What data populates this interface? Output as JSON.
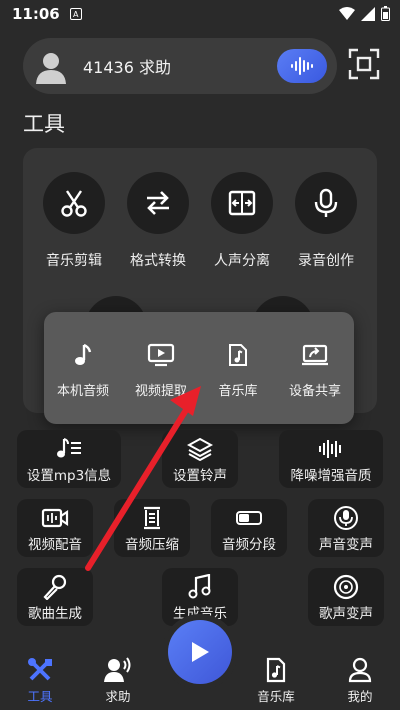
{
  "status_bar": {
    "time": "11:06",
    "notification_glyph": "A"
  },
  "search": {
    "user_id": "41436",
    "action": "求助",
    "text": "41436 求助"
  },
  "section": {
    "title": "工具"
  },
  "tools": [
    {
      "label": "音乐剪辑",
      "icon": "scissors-icon"
    },
    {
      "label": "格式转换",
      "icon": "swap-arrows-icon"
    },
    {
      "label": "人声分离",
      "icon": "split-icon"
    },
    {
      "label": "录音创作",
      "icon": "microphone-icon"
    }
  ],
  "popup": [
    {
      "label": "本机音频",
      "icon": "music-note-icon"
    },
    {
      "label": "视频提取",
      "icon": "video-play-icon"
    },
    {
      "label": "音乐库",
      "icon": "music-file-icon"
    },
    {
      "label": "设备共享",
      "icon": "screen-share-icon"
    }
  ],
  "cards": [
    {
      "label": "设置mp3信息",
      "icon": "mp3-info-icon"
    },
    {
      "label": "设置铃声",
      "icon": "layers-icon"
    },
    {
      "label": "降噪增强音质",
      "icon": "waveform-icon"
    },
    {
      "label": "视频配音",
      "icon": "video-dub-icon"
    },
    {
      "label": "音频压缩",
      "icon": "compress-icon"
    },
    {
      "label": "音频分段",
      "icon": "segment-icon"
    },
    {
      "label": "声音变声",
      "icon": "voice-change-icon"
    },
    {
      "label": "歌曲生成",
      "icon": "microphone-icon"
    },
    {
      "label": "生成音乐",
      "icon": "music-notes-icon"
    },
    {
      "label": "歌声变声",
      "icon": "disc-icon"
    }
  ],
  "nav": [
    {
      "label": "工具",
      "icon": "tools-icon",
      "active": true
    },
    {
      "label": "求助",
      "icon": "help-voice-icon",
      "active": false
    },
    {
      "label": "音乐库",
      "icon": "music-file-icon",
      "active": false
    },
    {
      "label": "我的",
      "icon": "person-icon",
      "active": false
    }
  ],
  "colors": {
    "background": "#2a2a2a",
    "accent": "#4d74ff",
    "annotation_arrow": "#e8202a"
  }
}
